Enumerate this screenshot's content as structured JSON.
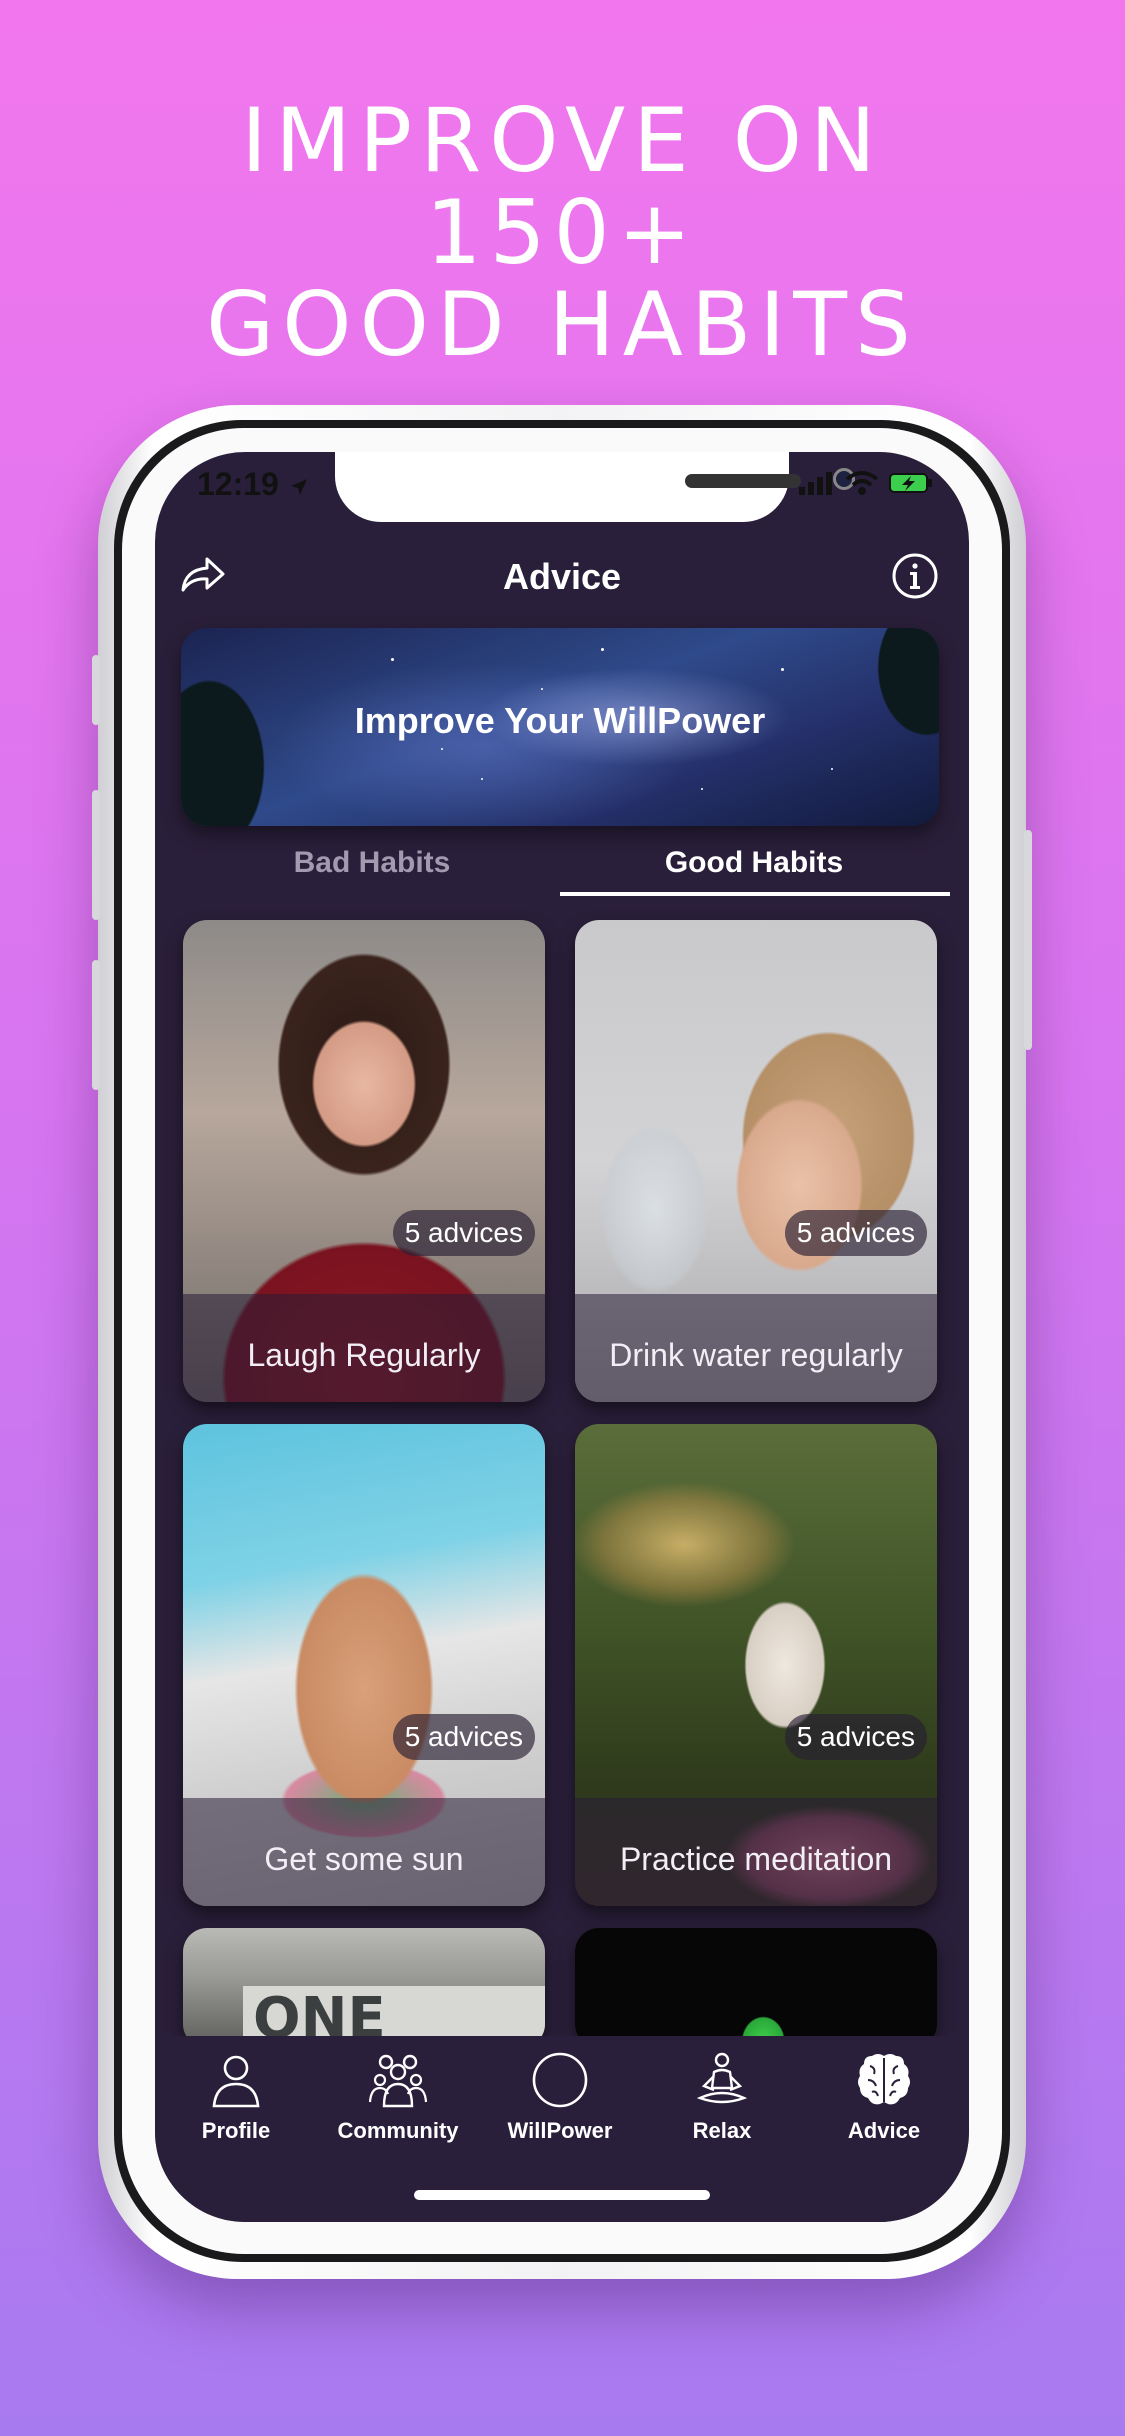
{
  "headline": [
    "IMPROVE ON",
    "150+",
    "GOOD HABITS"
  ],
  "status_bar": {
    "time": "12:19"
  },
  "nav": {
    "title": "Advice"
  },
  "banner": {
    "title": "Improve Your WillPower"
  },
  "tabs": [
    {
      "label": "Bad Habits",
      "selected": false
    },
    {
      "label": "Good Habits",
      "selected": true
    }
  ],
  "cards": [
    {
      "title": "Laugh Regularly",
      "badge": "5 advices"
    },
    {
      "title": "Drink water regularly",
      "badge": "5 advices"
    },
    {
      "title": "Get some sun",
      "badge": "5 advices"
    },
    {
      "title": "Practice meditation",
      "badge": "5 advices"
    },
    {
      "sign_text": "ONE SMALL"
    }
  ],
  "tabbar": [
    {
      "label": "Profile",
      "icon": "person-icon"
    },
    {
      "label": "Community",
      "icon": "group-icon"
    },
    {
      "label": "WillPower",
      "icon": "circle-icon"
    },
    {
      "label": "Relax",
      "icon": "meditation-icon"
    },
    {
      "label": "Advice",
      "icon": "brain-icon",
      "selected": true
    }
  ],
  "colors": {
    "background_top": "#f277ee",
    "background_bottom": "#a87af0",
    "screen": "#2a1f3a",
    "text": "#ffffff",
    "inactive_tab": "#a39ab0"
  }
}
